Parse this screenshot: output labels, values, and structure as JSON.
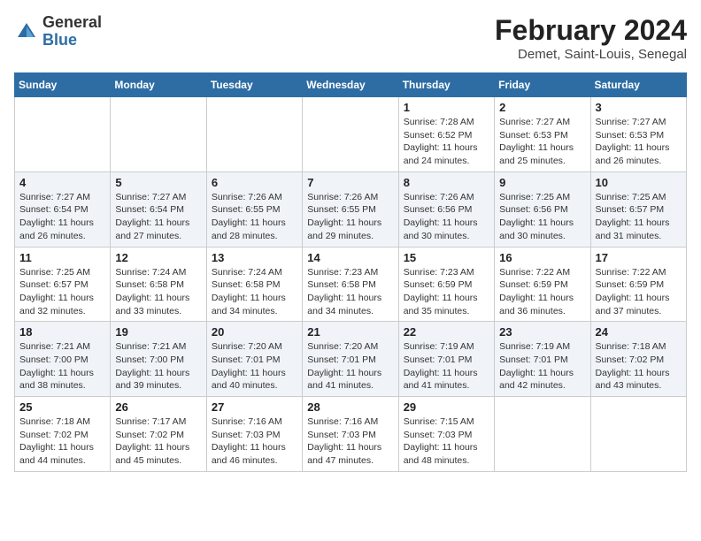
{
  "header": {
    "logo_general": "General",
    "logo_blue": "Blue",
    "title": "February 2024",
    "location": "Demet, Saint-Louis, Senegal"
  },
  "days_of_week": [
    "Sunday",
    "Monday",
    "Tuesday",
    "Wednesday",
    "Thursday",
    "Friday",
    "Saturday"
  ],
  "weeks": [
    [
      {
        "day": "",
        "info": ""
      },
      {
        "day": "",
        "info": ""
      },
      {
        "day": "",
        "info": ""
      },
      {
        "day": "",
        "info": ""
      },
      {
        "day": "1",
        "info": "Sunrise: 7:28 AM\nSunset: 6:52 PM\nDaylight: 11 hours and 24 minutes."
      },
      {
        "day": "2",
        "info": "Sunrise: 7:27 AM\nSunset: 6:53 PM\nDaylight: 11 hours and 25 minutes."
      },
      {
        "day": "3",
        "info": "Sunrise: 7:27 AM\nSunset: 6:53 PM\nDaylight: 11 hours and 26 minutes."
      }
    ],
    [
      {
        "day": "4",
        "info": "Sunrise: 7:27 AM\nSunset: 6:54 PM\nDaylight: 11 hours and 26 minutes."
      },
      {
        "day": "5",
        "info": "Sunrise: 7:27 AM\nSunset: 6:54 PM\nDaylight: 11 hours and 27 minutes."
      },
      {
        "day": "6",
        "info": "Sunrise: 7:26 AM\nSunset: 6:55 PM\nDaylight: 11 hours and 28 minutes."
      },
      {
        "day": "7",
        "info": "Sunrise: 7:26 AM\nSunset: 6:55 PM\nDaylight: 11 hours and 29 minutes."
      },
      {
        "day": "8",
        "info": "Sunrise: 7:26 AM\nSunset: 6:56 PM\nDaylight: 11 hours and 30 minutes."
      },
      {
        "day": "9",
        "info": "Sunrise: 7:25 AM\nSunset: 6:56 PM\nDaylight: 11 hours and 30 minutes."
      },
      {
        "day": "10",
        "info": "Sunrise: 7:25 AM\nSunset: 6:57 PM\nDaylight: 11 hours and 31 minutes."
      }
    ],
    [
      {
        "day": "11",
        "info": "Sunrise: 7:25 AM\nSunset: 6:57 PM\nDaylight: 11 hours and 32 minutes."
      },
      {
        "day": "12",
        "info": "Sunrise: 7:24 AM\nSunset: 6:58 PM\nDaylight: 11 hours and 33 minutes."
      },
      {
        "day": "13",
        "info": "Sunrise: 7:24 AM\nSunset: 6:58 PM\nDaylight: 11 hours and 34 minutes."
      },
      {
        "day": "14",
        "info": "Sunrise: 7:23 AM\nSunset: 6:58 PM\nDaylight: 11 hours and 34 minutes."
      },
      {
        "day": "15",
        "info": "Sunrise: 7:23 AM\nSunset: 6:59 PM\nDaylight: 11 hours and 35 minutes."
      },
      {
        "day": "16",
        "info": "Sunrise: 7:22 AM\nSunset: 6:59 PM\nDaylight: 11 hours and 36 minutes."
      },
      {
        "day": "17",
        "info": "Sunrise: 7:22 AM\nSunset: 6:59 PM\nDaylight: 11 hours and 37 minutes."
      }
    ],
    [
      {
        "day": "18",
        "info": "Sunrise: 7:21 AM\nSunset: 7:00 PM\nDaylight: 11 hours and 38 minutes."
      },
      {
        "day": "19",
        "info": "Sunrise: 7:21 AM\nSunset: 7:00 PM\nDaylight: 11 hours and 39 minutes."
      },
      {
        "day": "20",
        "info": "Sunrise: 7:20 AM\nSunset: 7:01 PM\nDaylight: 11 hours and 40 minutes."
      },
      {
        "day": "21",
        "info": "Sunrise: 7:20 AM\nSunset: 7:01 PM\nDaylight: 11 hours and 41 minutes."
      },
      {
        "day": "22",
        "info": "Sunrise: 7:19 AM\nSunset: 7:01 PM\nDaylight: 11 hours and 41 minutes."
      },
      {
        "day": "23",
        "info": "Sunrise: 7:19 AM\nSunset: 7:01 PM\nDaylight: 11 hours and 42 minutes."
      },
      {
        "day": "24",
        "info": "Sunrise: 7:18 AM\nSunset: 7:02 PM\nDaylight: 11 hours and 43 minutes."
      }
    ],
    [
      {
        "day": "25",
        "info": "Sunrise: 7:18 AM\nSunset: 7:02 PM\nDaylight: 11 hours and 44 minutes."
      },
      {
        "day": "26",
        "info": "Sunrise: 7:17 AM\nSunset: 7:02 PM\nDaylight: 11 hours and 45 minutes."
      },
      {
        "day": "27",
        "info": "Sunrise: 7:16 AM\nSunset: 7:03 PM\nDaylight: 11 hours and 46 minutes."
      },
      {
        "day": "28",
        "info": "Sunrise: 7:16 AM\nSunset: 7:03 PM\nDaylight: 11 hours and 47 minutes."
      },
      {
        "day": "29",
        "info": "Sunrise: 7:15 AM\nSunset: 7:03 PM\nDaylight: 11 hours and 48 minutes."
      },
      {
        "day": "",
        "info": ""
      },
      {
        "day": "",
        "info": ""
      }
    ]
  ]
}
